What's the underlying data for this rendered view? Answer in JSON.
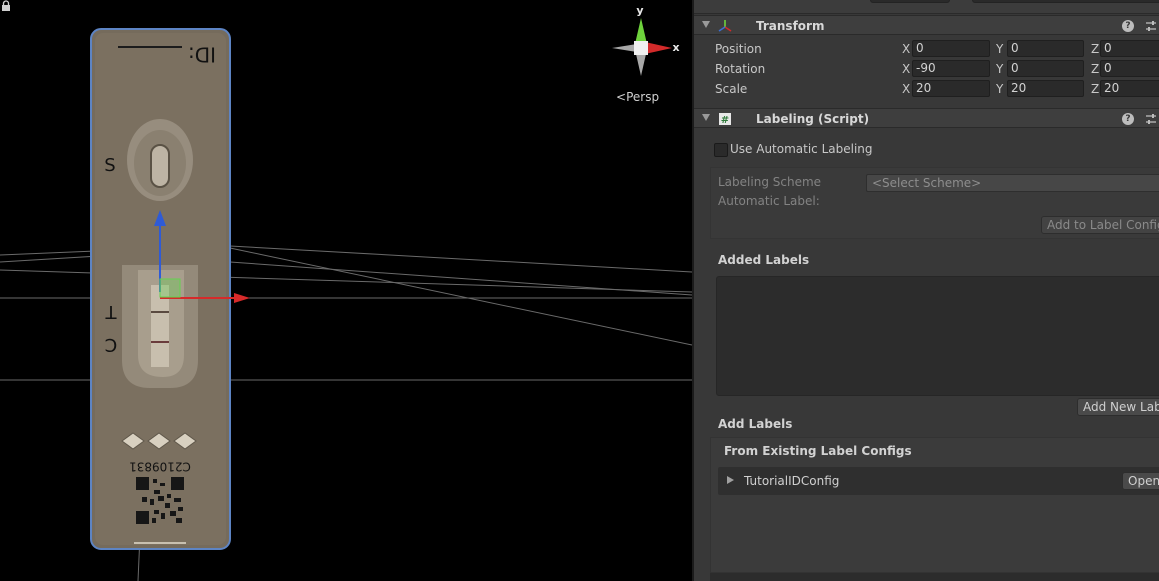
{
  "scene": {
    "gizmo": {
      "y_label": "y",
      "x_label": "x"
    },
    "persp_label": "Persp",
    "device": {
      "id_text": "ID:",
      "sample_letter": "S",
      "test_letter": "T",
      "control_letter": "C",
      "lot_code": "C2109831"
    }
  },
  "inspector": {
    "transform": {
      "title": "Transform",
      "rows": [
        {
          "label": "Position",
          "x": "0",
          "y": "0",
          "z": "0"
        },
        {
          "label": "Rotation",
          "x": "-90",
          "y": "0",
          "z": "0"
        },
        {
          "label": "Scale",
          "x": "20",
          "y": "20",
          "z": "20"
        }
      ],
      "axis_x": "X",
      "axis_y": "Y",
      "axis_z": "Z"
    },
    "labeling": {
      "title": "Labeling (Script)",
      "use_automatic_label": "Use Automatic Labeling",
      "labeling_scheme_label": "Labeling Scheme",
      "labeling_scheme_value": "<Select Scheme>",
      "automatic_label_label": "Automatic Label:",
      "add_to_label_config": "Add to Label Config..",
      "added_labels_title": "Added Labels",
      "add_new_label_button": "Add New Label",
      "add_labels_title": "Add Labels",
      "from_existing_title": "From Existing Label Configs",
      "config_name": "TutorialIDConfig",
      "open_button": "Open"
    }
  }
}
